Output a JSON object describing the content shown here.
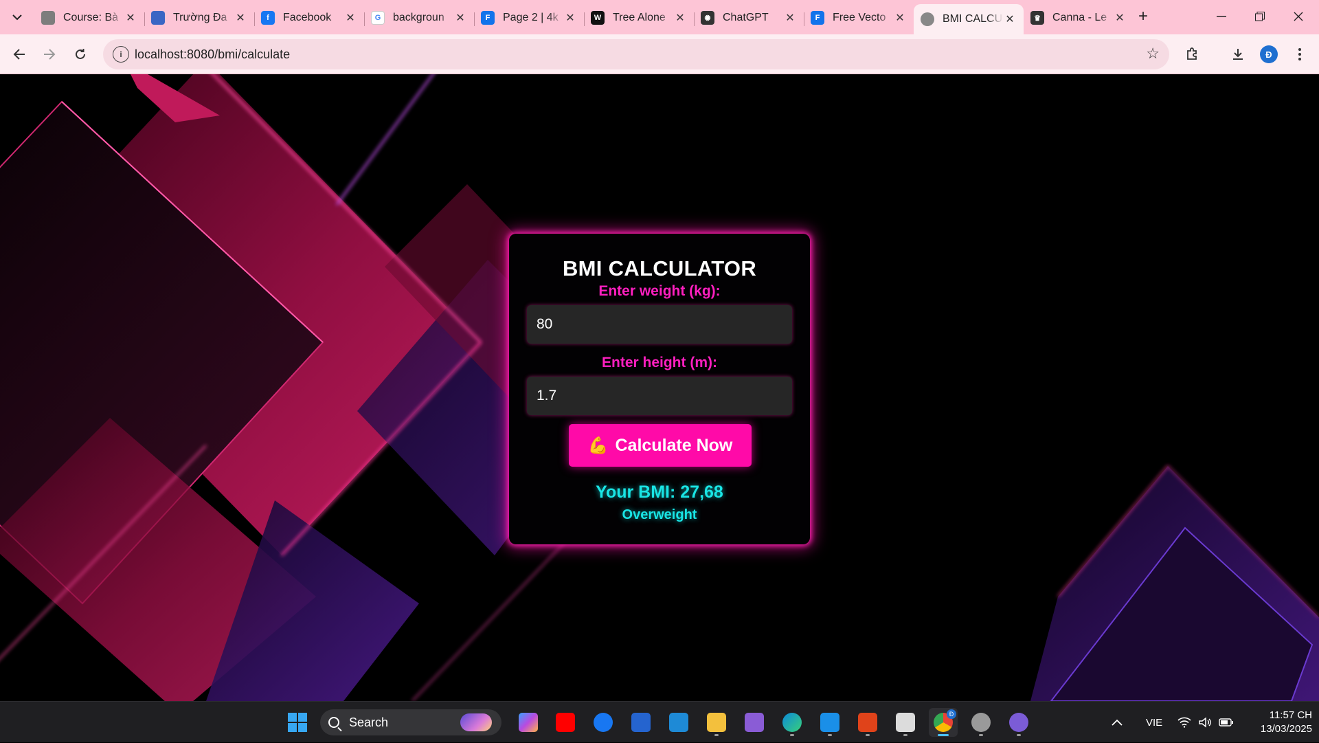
{
  "browser": {
    "tabs": [
      {
        "title": "Course: Bà",
        "icon": "course-favicon-icon",
        "color": "#7d7d7d"
      },
      {
        "title": "Trường Đa",
        "icon": "university-favicon-icon",
        "color": "#3a66c4"
      },
      {
        "title": "Facebook",
        "icon": "facebook-favicon-icon",
        "color": "#1877f2"
      },
      {
        "title": "backgroun",
        "icon": "google-favicon-icon",
        "color": "#ffffff"
      },
      {
        "title": "Page 2 | 4k",
        "icon": "freepik-favicon-icon",
        "color": "#1273eb"
      },
      {
        "title": "Tree Alone",
        "icon": "wallpaper-favicon-icon",
        "color": "#111111"
      },
      {
        "title": "ChatGPT",
        "icon": "chatgpt-favicon-icon",
        "color": "#333333"
      },
      {
        "title": "Free Vecto",
        "icon": "freepik-favicon-icon",
        "color": "#1273eb"
      },
      {
        "title": "BMI CALCU",
        "icon": "globe-favicon-icon",
        "color": "#888888",
        "active": true
      },
      {
        "title": "Canna - Le",
        "icon": "trophy-favicon-icon",
        "color": "#333333"
      }
    ],
    "url": "localhost:8080/bmi/calculate"
  },
  "bmi": {
    "title": "BMI CALCULATOR",
    "weight_label": "Enter weight (kg):",
    "weight_value": "80",
    "height_label": "Enter height (m):",
    "height_value": "1.7",
    "button_label": "Calculate Now",
    "button_icon": "flexed-biceps-icon",
    "result": "Your BMI: 27,68",
    "status": "Overweight"
  },
  "colors": {
    "accent_pink": "#ff0aa8",
    "label_pink": "#ff1fc0",
    "result_cyan": "#19e5e5",
    "tabstrip": "#fdc5d6"
  },
  "taskbar": {
    "search_placeholder": "Search",
    "apps": [
      "copilot-icon",
      "youtube-icon",
      "facebook-icon",
      "todo-icon",
      "vscode-icon",
      "file-explorer-icon",
      "visual-studio-icon",
      "edge-icon",
      "ultraview-icon",
      "app-icon",
      "teams-icon",
      "chrome-icon",
      "settings-icon",
      "github-icon"
    ],
    "language": "VIE",
    "time": "11:57 CH",
    "date": "13/03/2025",
    "chrome_badge": "Đ"
  },
  "profile_initial": "Đ"
}
